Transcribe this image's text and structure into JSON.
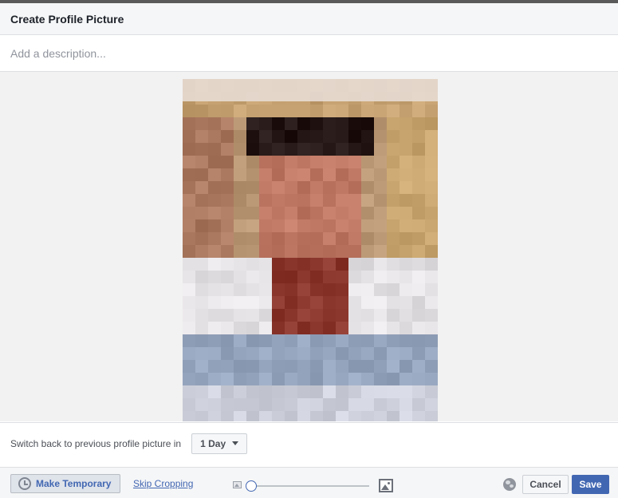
{
  "dialog": {
    "title": "Create Profile Picture",
    "description_placeholder": "Add a description...",
    "description_value": ""
  },
  "temporary": {
    "label": "Switch back to previous profile picture in",
    "duration": "1 Day"
  },
  "footer": {
    "make_temporary_label": "Make Temporary",
    "skip_cropping_label": "Skip Cropping",
    "zoom_level": 0,
    "cancel_label": "Cancel",
    "save_label": "Save"
  },
  "colors": {
    "accent": "#4267b2",
    "header_bg": "#f5f6f7",
    "stage_bg": "#f2f2f2"
  },
  "icons": {
    "temporary": "clock-icon",
    "zoom_out": "image-small-icon",
    "zoom_in": "image-large-icon",
    "privacy": "globe-icon",
    "duration_caret": "caret-down-icon"
  }
}
